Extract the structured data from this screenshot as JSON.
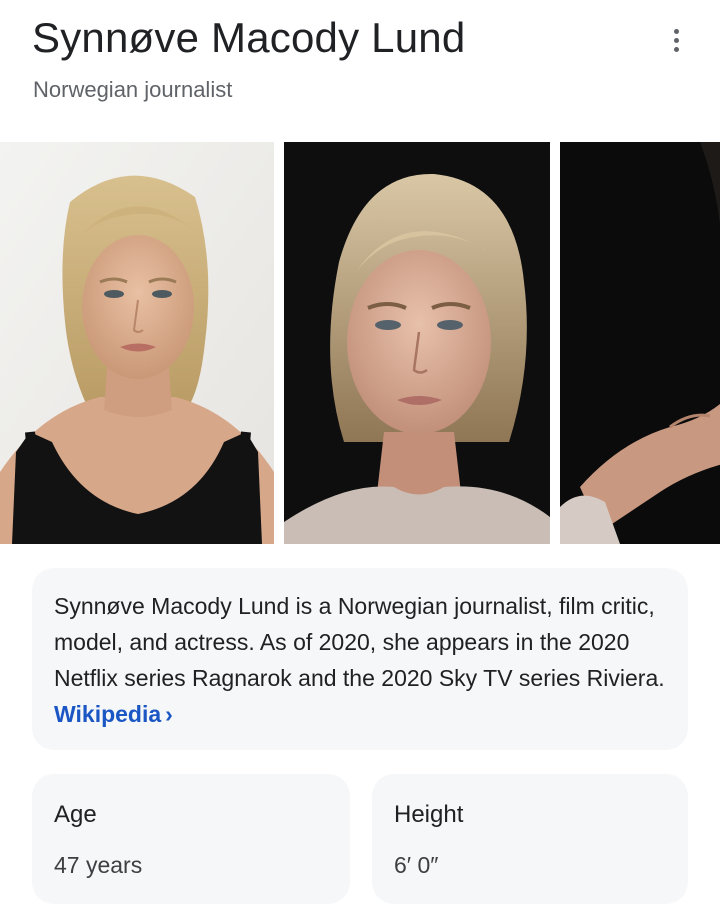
{
  "header": {
    "title": "Synnøve Macody Lund",
    "subtitle": "Norwegian journalist",
    "more_icon": "more-vertical-icon"
  },
  "gallery": {
    "images": [
      {
        "description": "portrait photo, light background"
      },
      {
        "description": "portrait photo, dark background"
      },
      {
        "description": "portrait photo, dark background, cropped"
      }
    ]
  },
  "description": {
    "text": "Synnøve Macody Lund is a Norwegian journalist, film critic, model, and actress. As of 2020, she appears in the 2020 Netflix series Ragnarok and the 2020 Sky TV series Riviera.",
    "source_link": "Wikipedia",
    "source_chevron": "›"
  },
  "facts": [
    {
      "label": "Age",
      "value": "47 years"
    },
    {
      "label": "Height",
      "value": "6′ 0″"
    }
  ],
  "colors": {
    "link": "#1a56c4",
    "card_bg": "#f6f7f9",
    "text": "#202124",
    "secondary_text": "#5f6368"
  }
}
